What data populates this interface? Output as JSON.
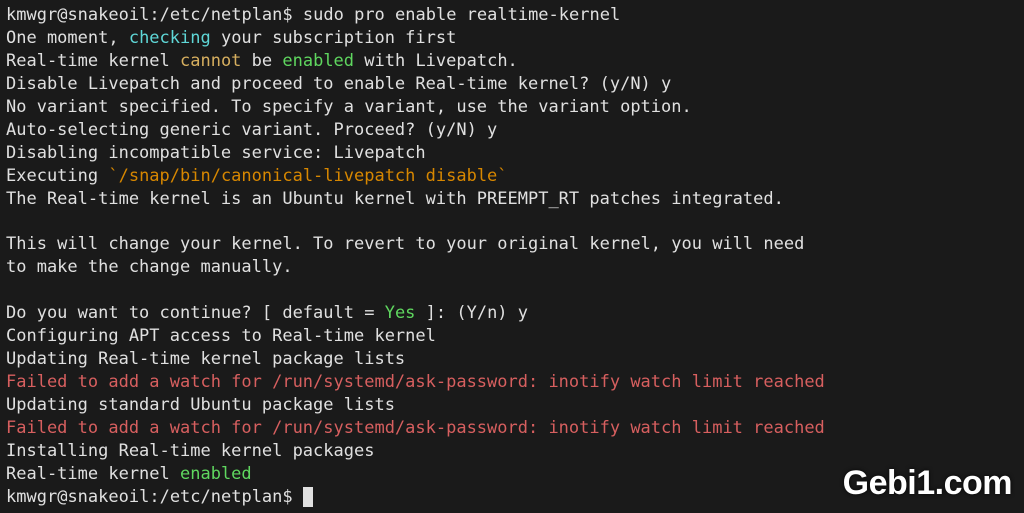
{
  "prompt1": {
    "user": "kmwgr",
    "host": "snakeoil",
    "path": "/etc/netplan",
    "symbol": "$"
  },
  "command": "sudo pro enable realtime-kernel",
  "lines": {
    "l1a": "One moment, ",
    "l1b": "checking",
    "l1c": " your subscription first",
    "l2a": "Real-time kernel ",
    "l2b": "cannot",
    "l2c": " be ",
    "l2d": "enabled",
    "l2e": " with Livepatch.",
    "l3": "Disable Livepatch and proceed to enable Real-time kernel? (y/N) y",
    "l4": "No variant specified. To specify a variant, use the variant option.",
    "l5": "Auto-selecting generic variant. Proceed? (y/N) y",
    "l6": "Disabling incompatible service: Livepatch",
    "l7a": "Executing ",
    "l7b": "`/snap/bin/canonical-livepatch disable`",
    "l8": "The Real-time kernel is an Ubuntu kernel with PREEMPT_RT patches integrated.",
    "l9": "",
    "l10": "This will change your kernel. To revert to your original kernel, you will need",
    "l11": "to make the change manually.",
    "l12": "",
    "l13a": "Do you want to continue? [ default = ",
    "l13b": "Yes",
    "l13c": " ]: (Y/n) y",
    "l14": "Configuring APT access to Real-time kernel",
    "l15": "Updating Real-time kernel package lists",
    "l16": "Failed to add a watch for /run/systemd/ask-password: inotify watch limit reached",
    "l17": "Updating standard Ubuntu package lists",
    "l18": "Failed to add a watch for /run/systemd/ask-password: inotify watch limit reached",
    "l19": "Installing Real-time kernel packages",
    "l20a": "Real-time kernel ",
    "l20b": "enabled"
  },
  "prompt2": {
    "user": "kmwgr",
    "host": "snakeoil",
    "path": "/etc/netplan",
    "symbol": "$"
  },
  "watermark": "Gebi1.com"
}
